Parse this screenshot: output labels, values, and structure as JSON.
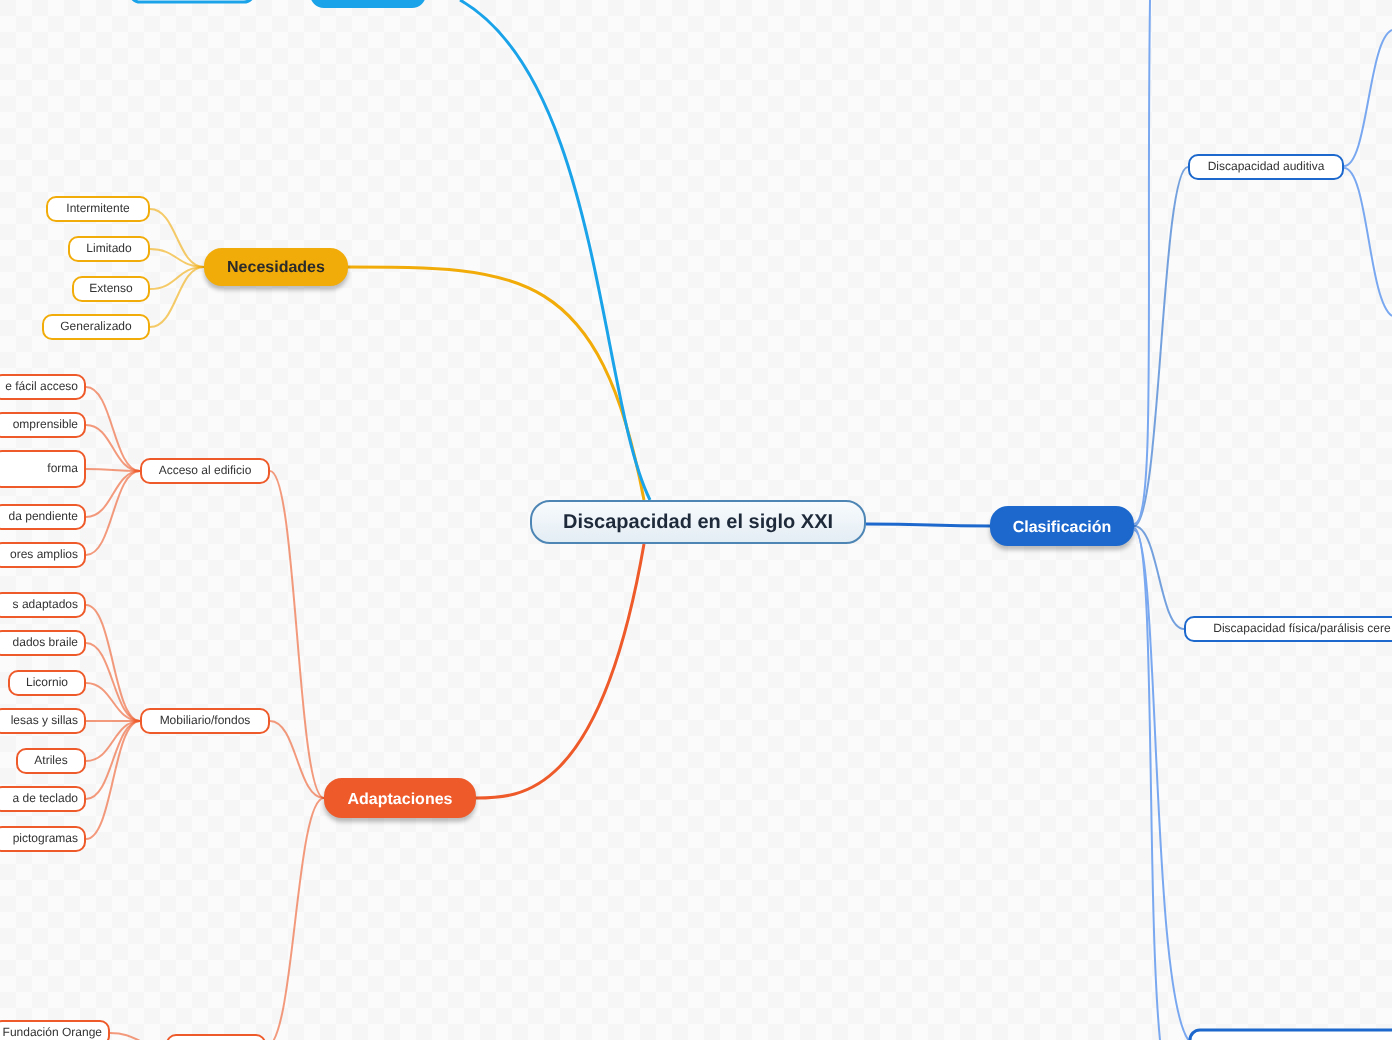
{
  "central": {
    "label": "Discapacidad en el siglo XXI"
  },
  "branches": [
    {
      "label": "Necesidades",
      "color": "#f2ac0a",
      "children": [
        {
          "label": "Intermitente"
        },
        {
          "label": "Limitado"
        },
        {
          "label": "Extenso"
        },
        {
          "label": "Generalizado"
        }
      ]
    },
    {
      "label": "Adaptaciones",
      "color": "#ee5a2a",
      "children": [
        {
          "label": "Acceso al edificio",
          "children": [
            {
              "label": "e fácil acceso"
            },
            {
              "label": "omprensible"
            },
            {
              "label": "forma"
            },
            {
              "label": "da pendiente"
            },
            {
              "label": "ores amplios"
            }
          ]
        },
        {
          "label": "Mobiliario/fondos",
          "children": [
            {
              "label": "s adaptados"
            },
            {
              "label": "dados braile"
            },
            {
              "label": "Licornio"
            },
            {
              "label": "lesas y sillas"
            },
            {
              "label": "Atriles"
            },
            {
              "label": "a de teclado"
            },
            {
              "label": "pictogramas"
            }
          ]
        },
        {
          "children": [
            {
              "label": "Fundación Orange"
            }
          ]
        }
      ]
    },
    {
      "label": "Clasificación",
      "color": "#1c68cc",
      "children": [
        {
          "label": "Discapacidad auditiva"
        },
        {
          "label": "Discapacidad física/parálisis cere"
        }
      ]
    }
  ]
}
